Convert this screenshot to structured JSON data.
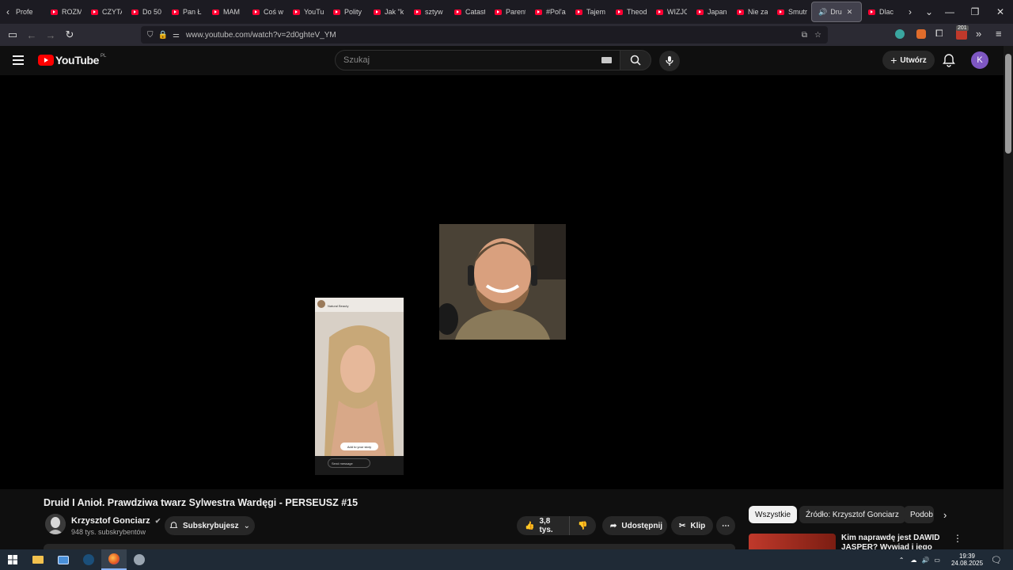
{
  "browser": {
    "tabs": [
      {
        "label": "Profe"
      },
      {
        "label": "ROZM"
      },
      {
        "label": "CZYTA"
      },
      {
        "label": "Do 50"
      },
      {
        "label": "Pan Ł"
      },
      {
        "label": "MAM"
      },
      {
        "label": "Coś w"
      },
      {
        "label": "YouTu"
      },
      {
        "label": "Polity"
      },
      {
        "label": "Jak \"k"
      },
      {
        "label": "sztyw"
      },
      {
        "label": "Catast"
      },
      {
        "label": "Parent"
      },
      {
        "label": "#Pol'a"
      },
      {
        "label": "Tajem"
      },
      {
        "label": "Theod"
      },
      {
        "label": "WIZJC"
      },
      {
        "label": "Japan"
      },
      {
        "label": "Nie za"
      },
      {
        "label": "Smutr"
      }
    ],
    "active_tab": {
      "label": "Dru"
    },
    "after_tab": {
      "label": "Dlac"
    },
    "url": "www.youtube.com/watch?v=2d0ghteV_YM",
    "extension_badge": "201"
  },
  "youtube": {
    "logo_text": "YouTube",
    "country_code": "PL",
    "search_placeholder": "Szukaj",
    "create_label": "Utwórz",
    "avatar_letter": "K"
  },
  "video": {
    "story_header": "Natural Beauty",
    "story_add": "Add to your story",
    "story_message": "Send message",
    "title": "Druid I Anioł. Prawdziwa twarz Sylwestra Wardęgi - PERSEUSZ #15",
    "channel_name": "Krzysztof Gonciarz",
    "subscribers": "948 tys. subskrybentów",
    "subscribe_label": "Subskrybujesz",
    "likes": "3,8 tys.",
    "share_label": "Udostępnij",
    "clip_label": "Klip"
  },
  "recommendations": {
    "chips": [
      "Wszystkie",
      "Źródło: Krzysztof Gonciarz",
      "Podob"
    ],
    "first_title": "Kim naprawdę jest DAWID JASPER? Wywiad i jego"
  },
  "taskbar": {
    "time": "19:39",
    "date": "24.08.2025"
  }
}
